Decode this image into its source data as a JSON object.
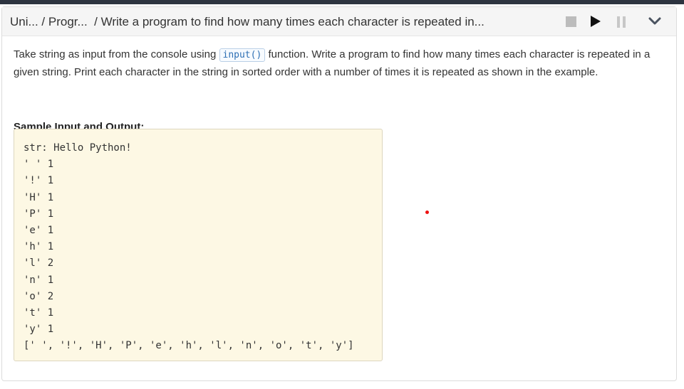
{
  "header": {
    "breadcrumb": [
      "Uni...",
      " / ",
      "Progr...",
      "  / ",
      "Write a program to find how many times each character is repeated in..."
    ],
    "controls": [
      "stop-icon",
      "play-icon",
      "pause-icon",
      "chevron-down-icon"
    ]
  },
  "content": {
    "text_before_code": "Take string as input from the console using ",
    "inline_code": "input()",
    "text_after_code": " function. Write a program to find how many times each character is repeated in a given string. Print each character in the string in sorted order with a number of times it is repeated as shown in the example."
  },
  "sample": {
    "title": "Sample Input and Output:",
    "lines": [
      "str: Hello Python!",
      "' ' 1",
      "'!' 1",
      "'H' 1",
      "'P' 1",
      "'e' 1",
      "'h' 1",
      "'l' 2",
      "'n' 1",
      "'o' 2",
      "'t' 1",
      "'y' 1",
      "[' ', '!', 'H', 'P', 'e', 'h', 'l', 'n', 'o', 't', 'y']"
    ]
  },
  "colors": {
    "header_bg": "#f5f5f5",
    "sample_bg": "#fdf8e4",
    "inline_code_color": "#2d6fb3",
    "red_dot": "#e11111"
  }
}
